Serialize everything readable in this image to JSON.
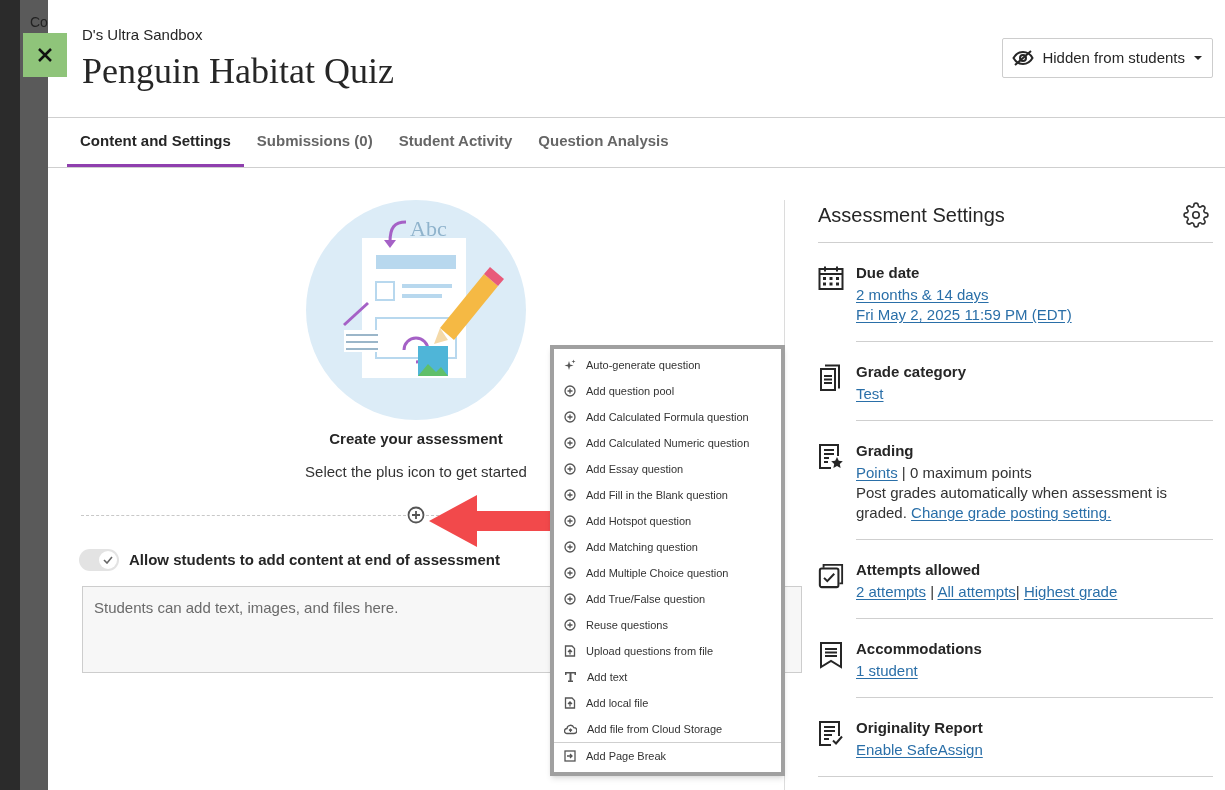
{
  "background": {
    "text": "Co"
  },
  "header": {
    "course": "D's Ultra Sandbox",
    "title": "Penguin Habitat Quiz",
    "visibility": "Hidden from students"
  },
  "tabs": [
    {
      "label": "Content and Settings",
      "selected": true
    },
    {
      "label": "Submissions (0)",
      "selected": false
    },
    {
      "label": "Student Activity",
      "selected": false
    },
    {
      "label": "Question Analysis",
      "selected": false
    }
  ],
  "create": {
    "illustration_label": "Abc",
    "heading": "Create your assessment",
    "hint": "Select the plus icon to get started"
  },
  "allow_content": {
    "label": "Allow students to add content at end of assessment",
    "on": true,
    "placeholder": "Students can add text, images, and files here."
  },
  "menu": [
    {
      "kind": "sparkle",
      "label": "Auto-generate question"
    },
    {
      "kind": "plus",
      "label": "Add question pool"
    },
    {
      "kind": "plus",
      "label": "Add Calculated Formula question"
    },
    {
      "kind": "plus",
      "label": "Add Calculated Numeric question"
    },
    {
      "kind": "plus",
      "label": "Add Essay question"
    },
    {
      "kind": "plus",
      "label": "Add Fill in the Blank question"
    },
    {
      "kind": "plus",
      "label": "Add Hotspot question"
    },
    {
      "kind": "plus",
      "label": "Add Matching question"
    },
    {
      "kind": "plus",
      "label": "Add Multiple Choice question"
    },
    {
      "kind": "plus",
      "label": "Add True/False question"
    },
    {
      "kind": "plus",
      "label": "Reuse questions"
    },
    {
      "kind": "upload",
      "label": "Upload questions from file"
    },
    {
      "kind": "text",
      "label": "Add text"
    },
    {
      "kind": "upload",
      "label": "Add local file"
    },
    {
      "kind": "cloud",
      "label": "Add file from Cloud Storage"
    },
    {
      "kind": "pagebreak",
      "label": "Add Page Break"
    }
  ],
  "settings": {
    "title": "Assessment Settings",
    "items": [
      {
        "kind": "calendar",
        "title": "Due date",
        "lines": [
          [
            {
              "text": "2 months & 14 days",
              "link": true
            }
          ],
          [
            {
              "text": "Fri May 2, 2025 11:59 PM (EDT)",
              "link": true
            }
          ]
        ]
      },
      {
        "kind": "pages",
        "title": "Grade category",
        "lines": [
          [
            {
              "text": "Test",
              "link": true
            }
          ]
        ]
      },
      {
        "kind": "grading",
        "title": "Grading",
        "lines": [
          [
            {
              "text": "Points",
              "link": true
            },
            {
              "text": " | 0 maximum points",
              "link": false
            }
          ],
          [
            {
              "text": "Post grades automatically when assessment is graded. ",
              "link": false
            },
            {
              "text": "Change grade posting setting.",
              "link": true
            }
          ]
        ]
      },
      {
        "kind": "attempts",
        "title": "Attempts allowed",
        "lines": [
          [
            {
              "text": "2 attempts",
              "link": true
            },
            {
              "text": " | ",
              "link": false
            },
            {
              "text": "All attempts",
              "link": true
            },
            {
              "text": "| ",
              "link": false
            },
            {
              "text": "Highest grade",
              "link": true
            }
          ]
        ]
      },
      {
        "kind": "bookmark",
        "title": "Accommodations",
        "lines": [
          [
            {
              "text": "1 student",
              "link": true
            }
          ]
        ]
      },
      {
        "kind": "report",
        "title": "Originality Report",
        "lines": [
          [
            {
              "text": "Enable SafeAssign",
              "link": true
            }
          ]
        ]
      }
    ]
  }
}
